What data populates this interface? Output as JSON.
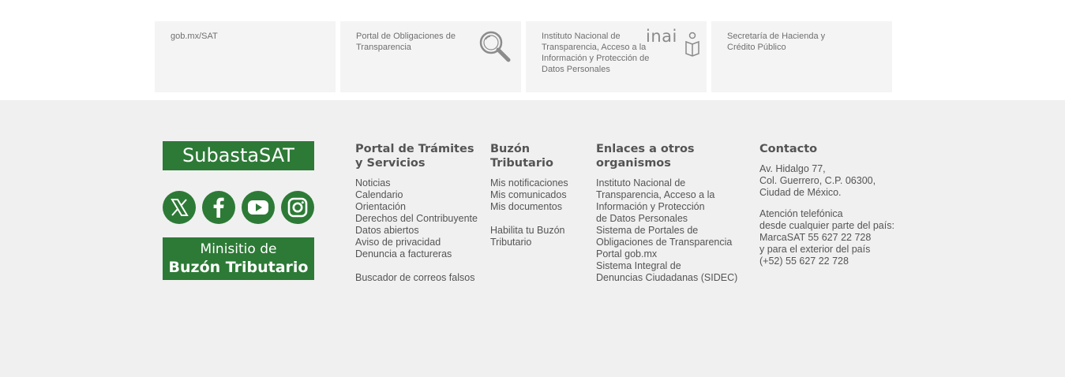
{
  "cards": [
    {
      "label": "gob.mx/SAT"
    },
    {
      "label": "Portal de Obligaciones de Transparencia",
      "icon": "search-magnifier-icon"
    },
    {
      "label": "Instituto Nacional de Transparencia, Acceso a la Información y Protección de Datos Personales",
      "logo_text": "inai",
      "icon": "inai-logo"
    },
    {
      "label": "Secretaría de Hacienda y Crédito Público"
    }
  ],
  "footer": {
    "subasta_label": "SubastaSAT",
    "social": [
      {
        "icon": "x-twitter-icon"
      },
      {
        "icon": "facebook-icon"
      },
      {
        "icon": "youtube-icon"
      },
      {
        "icon": "instagram-icon"
      }
    ],
    "buzon_line1": "Minisitio de",
    "buzon_line2": "Buzón Tributario",
    "col1": {
      "title_l1": "Portal de Trámites",
      "title_l2": "y Servicios",
      "links": [
        "Noticias",
        "Calendario",
        "Orientación",
        "Derechos del Contribuyente",
        "Datos abiertos",
        "Aviso de privacidad",
        "Denuncia a factureras"
      ],
      "extra": "Buscador de correos falsos"
    },
    "col2": {
      "title": "Buzón Tributario",
      "links": [
        "Mis notificaciones",
        "Mis comunicados",
        "Mis documentos"
      ],
      "extra_l1": "Habilita tu Buzón",
      "extra_l2": "Tributario"
    },
    "col3": {
      "title": "Enlaces a otros organismos",
      "link1": [
        "Instituto Nacional de",
        "Transparencia, Acceso a la",
        "Información y Protección",
        "de Datos Personales"
      ],
      "link2": [
        "Sistema de Portales de",
        "Obligaciones de Transparencia"
      ],
      "link3": "Portal gob.mx",
      "link4": [
        "Sistema Integral de",
        "Denuncias Ciudadanas (SIDEC)"
      ]
    },
    "col4": {
      "title": "Contacto",
      "address": [
        "Av. Hidalgo 77,",
        "Col. Guerrero, C.P. 06300,",
        "Ciudad de México."
      ],
      "phone": [
        "Atención telefónica",
        "desde cualquier parte del país:",
        "MarcaSAT 55 627 22 728",
        "y para el exterior del país",
        "(+52) 55 627 22 728"
      ]
    },
    "accent_color": "#2d7a36"
  }
}
